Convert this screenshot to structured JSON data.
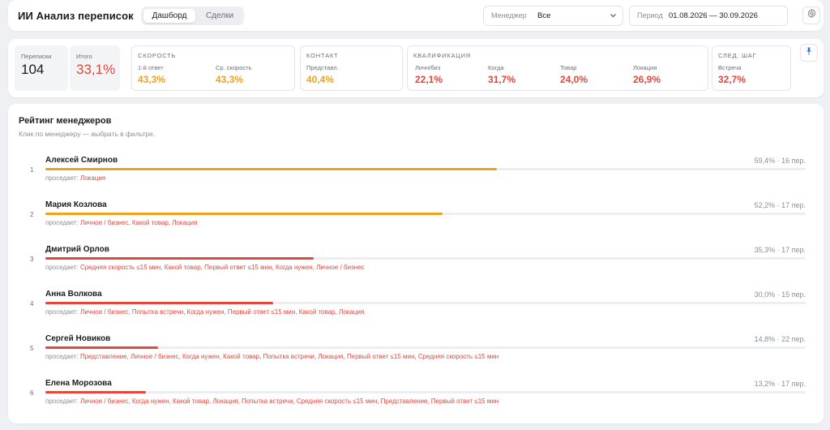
{
  "header": {
    "title": "ИИ Анализ переписок",
    "tabs": [
      "Дашборд",
      "Сделки"
    ],
    "manager_label": "Менеджер",
    "manager_value": "Все",
    "period_label": "Период",
    "period_value": "01.08.2026 — 30.09.2026"
  },
  "colors": {
    "red": "#e0483e",
    "orange": "#f0a21e"
  },
  "stats": {
    "chats": {
      "label": "Переписки",
      "value": "104"
    },
    "total": {
      "label": "Итого",
      "value": "33,1%"
    },
    "groups": [
      {
        "title": "Скорость",
        "metrics": [
          {
            "label": "1-й ответ",
            "value": "43,3%"
          },
          {
            "label": "Ср. скорость",
            "value": "43,3%"
          }
        ]
      },
      {
        "title": "Контакт",
        "metrics": [
          {
            "label": "Представл.",
            "value": "40,4%"
          }
        ]
      },
      {
        "title": "Квалификация",
        "metrics": [
          {
            "label": "Личн/биз",
            "value": "22,1%"
          },
          {
            "label": "Когда",
            "value": "31,7%"
          },
          {
            "label": "Товар",
            "value": "24,0%"
          },
          {
            "label": "Локация",
            "value": "26,9%"
          }
        ]
      },
      {
        "title": "След. шаг",
        "metrics": [
          {
            "label": "Встреча",
            "value": "32,7%"
          }
        ]
      }
    ]
  },
  "rating": {
    "title": "Рейтинг менеджеров",
    "subtitle": "Клик по менеджеру — выбрать в фильтре.",
    "sag_label": "проседает:",
    "managers": [
      {
        "rank": "1",
        "name": "Алексей Смирнов",
        "stat": "59,4% · 16 пер.",
        "score": 0.594,
        "sag": "Локация"
      },
      {
        "rank": "2",
        "name": "Мария Козлова",
        "stat": "52,2% · 17 пер.",
        "score": 0.522,
        "sag": "Личное / бизнес, Какой товар, Локация"
      },
      {
        "rank": "3",
        "name": "Дмитрий Орлов",
        "stat": "35,3% · 17 пер.",
        "score": 0.353,
        "sag": "Средняя скорость ≤15 мин, Какой товар, Первый ответ ≤15 мин, Когда нужен, Личное / бизнес"
      },
      {
        "rank": "4",
        "name": "Анна Волкова",
        "stat": "30,0% · 15 пер.",
        "score": 0.3,
        "sag": "Личное / бизнес, Попытка встречи, Когда нужен, Первый ответ ≤15 мин, Какой товар, Локация"
      },
      {
        "rank": "5",
        "name": "Сергей Новиков",
        "stat": "14,8% · 22 пер.",
        "score": 0.148,
        "sag": "Представление, Личное / бизнес, Когда нужен, Какой товар, Попытка встречи, Локация, Первый ответ ≤15 мин, Средняя скорость ≤15 мин"
      },
      {
        "rank": "6",
        "name": "Елена Морозова",
        "stat": "13,2% · 17 пер.",
        "score": 0.132,
        "sag": "Личное / бизнес, Когда нужен, Какой товар, Локация, Попытка встречи, Средняя скорость ≤15 мин, Представление, Первый ответ ≤15 мин"
      }
    ]
  }
}
